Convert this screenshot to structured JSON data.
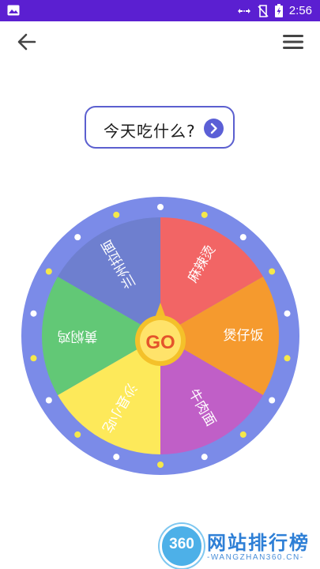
{
  "status_bar": {
    "time": "2:56",
    "icons": [
      "image-icon",
      "data-arrows-icon",
      "no-signal-icon",
      "battery-charging-icon"
    ]
  },
  "app_bar": {
    "back_icon": "arrow-left-icon",
    "menu_icon": "hamburger-menu-icon"
  },
  "question": {
    "text": "今天吃什么?",
    "button_icon": "chevron-right-icon"
  },
  "wheel": {
    "go_label": "GO",
    "segments": [
      {
        "label": "麻辣烫",
        "color": "#f26565"
      },
      {
        "label": "煲仔饭",
        "color": "#f59a2e"
      },
      {
        "label": "牛肉面",
        "color": "#c05fc7"
      },
      {
        "label": "沙县小吃",
        "color": "#fde95a"
      },
      {
        "label": "黄焖鸡",
        "color": "#62c876"
      },
      {
        "label": "兰州拉面",
        "color": "#6e7fcf"
      }
    ],
    "rim_color": "#7b8be8",
    "light_colors": [
      "#ffffff",
      "#f5e84a"
    ]
  },
  "watermark": {
    "badge": "360",
    "title": "网站排行榜",
    "subtitle": "-WANGZHAN360.CN-"
  }
}
